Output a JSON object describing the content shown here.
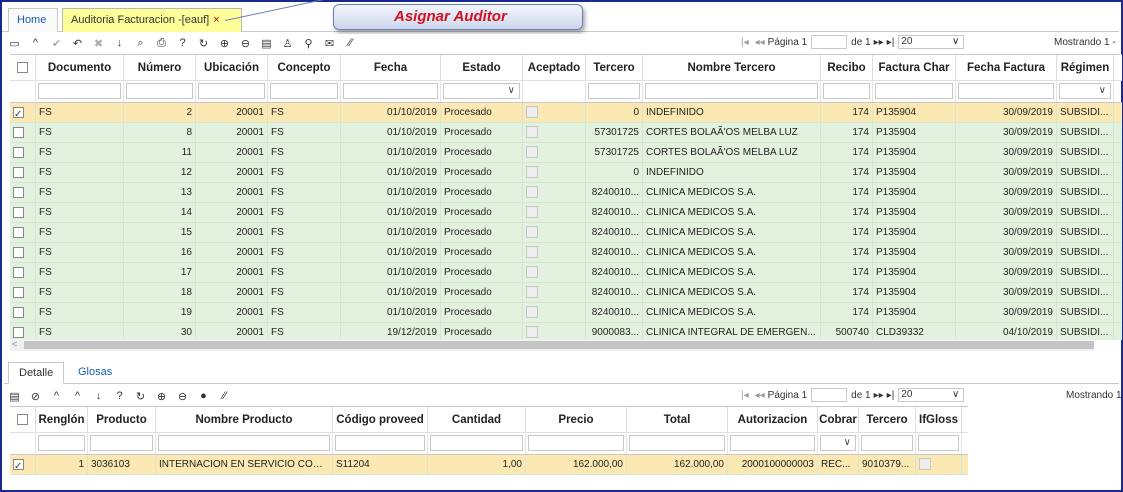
{
  "tabs": {
    "home": "Home",
    "active": "Auditoria Facturacion -[eauf]",
    "close": "×"
  },
  "callout": "Asignar Auditor",
  "top_pager": {
    "page_label": "Página 1",
    "of_label": "de 1",
    "page_size": "20",
    "showing": "Mostrando 1 -"
  },
  "bottom_pager": {
    "page_label": "Página 1",
    "of_label": "de 1",
    "page_size": "20",
    "showing": "Mostrando 1"
  },
  "toolbar_icons": [
    "new-icon",
    "up-icon",
    "accept-icon",
    "undo-icon",
    "delete-icon",
    "down-icon",
    "search-icon",
    "print-icon",
    "help-icon",
    "refresh-icon",
    "zoom-in-icon",
    "zoom-out-icon",
    "comment-icon",
    "user-icon",
    "pin-icon",
    "mail-icon",
    "resize-icon"
  ],
  "toolbar_glyphs": [
    "▭",
    "^",
    "✔",
    "↶",
    "✖",
    "↓",
    "⌕",
    "⎙",
    "?",
    "↻",
    "⊕",
    "⊖",
    "▤",
    "♙",
    "⚲",
    "✉",
    "⁄⁄"
  ],
  "main_columns": [
    "Documento",
    "Número",
    "Ubicación",
    "Concepto",
    "Fecha",
    "Estado",
    "Aceptado",
    "Tercero",
    "Nombre Tercero",
    "Recibo",
    "Factura Char",
    "Fecha Factura",
    "Régimen"
  ],
  "main_rows": [
    {
      "doc": "FS",
      "num": "2",
      "ubic": "20001",
      "conc": "FS",
      "fecha": "01/10/2019",
      "estado": "Procesado",
      "tercero": "0",
      "nombre": "INDEFINIDO",
      "recibo": "174",
      "factura": "P135904",
      "ffact": "30/09/2019",
      "regimen": "SUBSIDI..."
    },
    {
      "doc": "FS",
      "num": "8",
      "ubic": "20001",
      "conc": "FS",
      "fecha": "01/10/2019",
      "estado": "Procesado",
      "tercero": "57301725",
      "nombre": "CORTES BOLAÃ'OS MELBA LUZ",
      "recibo": "174",
      "factura": "P135904",
      "ffact": "30/09/2019",
      "regimen": "SUBSIDI..."
    },
    {
      "doc": "FS",
      "num": "11",
      "ubic": "20001",
      "conc": "FS",
      "fecha": "01/10/2019",
      "estado": "Procesado",
      "tercero": "57301725",
      "nombre": "CORTES BOLAÃ'OS MELBA LUZ",
      "recibo": "174",
      "factura": "P135904",
      "ffact": "30/09/2019",
      "regimen": "SUBSIDI..."
    },
    {
      "doc": "FS",
      "num": "12",
      "ubic": "20001",
      "conc": "FS",
      "fecha": "01/10/2019",
      "estado": "Procesado",
      "tercero": "0",
      "nombre": "INDEFINIDO",
      "recibo": "174",
      "factura": "P135904",
      "ffact": "30/09/2019",
      "regimen": "SUBSIDI..."
    },
    {
      "doc": "FS",
      "num": "13",
      "ubic": "20001",
      "conc": "FS",
      "fecha": "01/10/2019",
      "estado": "Procesado",
      "tercero": "8240010...",
      "nombre": "CLINICA MEDICOS S.A.",
      "recibo": "174",
      "factura": "P135904",
      "ffact": "30/09/2019",
      "regimen": "SUBSIDI..."
    },
    {
      "doc": "FS",
      "num": "14",
      "ubic": "20001",
      "conc": "FS",
      "fecha": "01/10/2019",
      "estado": "Procesado",
      "tercero": "8240010...",
      "nombre": "CLINICA MEDICOS S.A.",
      "recibo": "174",
      "factura": "P135904",
      "ffact": "30/09/2019",
      "regimen": "SUBSIDI..."
    },
    {
      "doc": "FS",
      "num": "15",
      "ubic": "20001",
      "conc": "FS",
      "fecha": "01/10/2019",
      "estado": "Procesado",
      "tercero": "8240010...",
      "nombre": "CLINICA MEDICOS S.A.",
      "recibo": "174",
      "factura": "P135904",
      "ffact": "30/09/2019",
      "regimen": "SUBSIDI..."
    },
    {
      "doc": "FS",
      "num": "16",
      "ubic": "20001",
      "conc": "FS",
      "fecha": "01/10/2019",
      "estado": "Procesado",
      "tercero": "8240010...",
      "nombre": "CLINICA MEDICOS S.A.",
      "recibo": "174",
      "factura": "P135904",
      "ffact": "30/09/2019",
      "regimen": "SUBSIDI..."
    },
    {
      "doc": "FS",
      "num": "17",
      "ubic": "20001",
      "conc": "FS",
      "fecha": "01/10/2019",
      "estado": "Procesado",
      "tercero": "8240010...",
      "nombre": "CLINICA MEDICOS S.A.",
      "recibo": "174",
      "factura": "P135904",
      "ffact": "30/09/2019",
      "regimen": "SUBSIDI..."
    },
    {
      "doc": "FS",
      "num": "18",
      "ubic": "20001",
      "conc": "FS",
      "fecha": "01/10/2019",
      "estado": "Procesado",
      "tercero": "8240010...",
      "nombre": "CLINICA MEDICOS S.A.",
      "recibo": "174",
      "factura": "P135904",
      "ffact": "30/09/2019",
      "regimen": "SUBSIDI..."
    },
    {
      "doc": "FS",
      "num": "19",
      "ubic": "20001",
      "conc": "FS",
      "fecha": "01/10/2019",
      "estado": "Procesado",
      "tercero": "8240010...",
      "nombre": "CLINICA MEDICOS S.A.",
      "recibo": "174",
      "factura": "P135904",
      "ffact": "30/09/2019",
      "regimen": "SUBSIDI..."
    },
    {
      "doc": "FS",
      "num": "30",
      "ubic": "20001",
      "conc": "FS",
      "fecha": "19/12/2019",
      "estado": "Procesado",
      "tercero": "9000083...",
      "nombre": "CLINICA INTEGRAL DE EMERGEN...",
      "recibo": "500740",
      "factura": "CLD39332",
      "ffact": "04/10/2019",
      "regimen": "SUBSIDI..."
    }
  ],
  "subtabs": [
    "Detalle",
    "Glosas"
  ],
  "detail_columns": [
    "Renglón",
    "Producto",
    "Nombre Producto",
    "Código proveed",
    "Cantidad",
    "Precio",
    "Total",
    "Autorizacion",
    "Cobrar",
    "Tercero",
    "IfGloss"
  ],
  "detail_rows": [
    {
      "reng": "1",
      "prod": "3036103",
      "nombre": "INTERNACION EN SERVICIO COM...",
      "codprov": "S11204",
      "cant": "1,00",
      "precio": "162.000,00",
      "total": "162.000,00",
      "autoriz": "2000100000003",
      "cobrar": "REC...",
      "tercero": "9010379..."
    }
  ],
  "colors": {
    "selected_row": "#fce8b2",
    "row": "#e3f2de",
    "frame": "#1a2a8c",
    "callout_text": "#d4101f",
    "tab_active": "#ffff99"
  }
}
